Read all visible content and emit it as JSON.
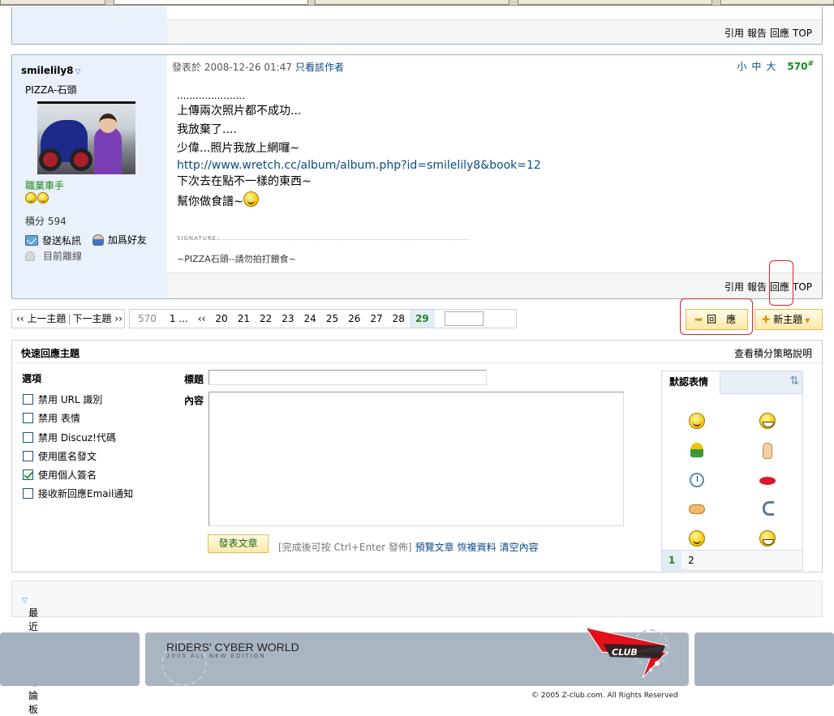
{
  "prev_post": {
    "actions": [
      "引用",
      "報告",
      "回應",
      "TOP"
    ]
  },
  "post": {
    "username": "smilelily8",
    "user_title": "PIZZA-石頭",
    "rank": "職業車手",
    "credits_label": "積分",
    "credits_value": "594",
    "send_pm": "發送私訊",
    "add_friend": "加爲好友",
    "status": "目前離線",
    "posted_at_label": "發表於",
    "posted_at": "2008-12-26 01:47",
    "only_author": "只看該作者",
    "font_small": "小",
    "font_medium": "中",
    "font_large": "大",
    "floor": "570",
    "floor_mark": "#",
    "content": {
      "dots": "......................",
      "line1": "上傳兩次照片都不成功...",
      "line2": "我放棄了....",
      "line3": "少偉...照片我放上網囉~",
      "link": "http://www.wretch.cc/album/album.php?id=smilelily8&book=12",
      "line4": "下次去在點不一樣的東西~",
      "line5": "幫你做食譜~"
    },
    "signature_label": "SIGNATURE:",
    "signature": "~PIZZA石頭--請勿拍打餵食~",
    "actions": [
      "引用",
      "報告",
      "回應",
      "TOP"
    ]
  },
  "pagination": {
    "prev_topic": "上一主題",
    "next_topic": "下一主題",
    "total": "570",
    "first": "1 ...",
    "back": "‹‹",
    "pages": [
      "20",
      "21",
      "22",
      "23",
      "24",
      "25",
      "26",
      "27",
      "28"
    ],
    "current": "29",
    "jump_value": ""
  },
  "buttons": {
    "reply": "回　應",
    "new_topic": "新主題"
  },
  "quick_reply": {
    "title": "快速回應主題",
    "policy_link": "查看積分策略說明",
    "options_title": "選項",
    "options": [
      {
        "label": "禁用 URL 識別",
        "checked": false
      },
      {
        "label": "禁用 表情",
        "checked": false
      },
      {
        "label": "禁用 Discuz!代碼",
        "checked": false
      },
      {
        "label": "使用匿名發文",
        "checked": false
      },
      {
        "label": "使用個人簽名",
        "checked": true
      },
      {
        "label": "接收新回應Email通知",
        "checked": false
      }
    ],
    "subject_label": "標題",
    "subject_value": "",
    "content_label": "內容",
    "content_value": "",
    "submit": "發表文章",
    "hint": "[完成後可按 Ctrl+Enter 發佈]",
    "preview": "預覽文章",
    "restore": "恢複資料",
    "clear": "清空內容",
    "emoticons_tab": "默認表情",
    "emoticon_pages": [
      "1",
      "2"
    ]
  },
  "recent_forums": "最近瀏覽的討論板",
  "footer": {
    "title": "RIDERS' CYBER WORLD",
    "subtitle": "2005 ALL NEW EDITION",
    "logo_text": "CLUB",
    "copyright": "© 2005 Z-club.com. All Rights Reserved"
  },
  "colors": {
    "link": "#0b4a8a",
    "accent_green": "#1a8a1a",
    "button_bg": "#fde8a6",
    "side_bg": "#eaf1fa"
  }
}
